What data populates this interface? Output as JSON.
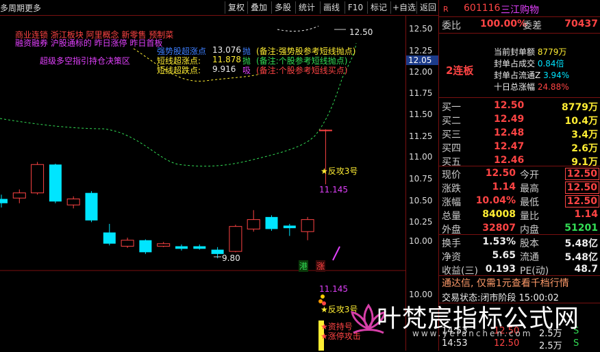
{
  "toolbar": {
    "period": "多周期",
    "more": "更多",
    "buttons": [
      "复权",
      "叠加",
      "多股",
      "统计",
      "画线",
      "F10",
      "标记",
      "+自选",
      "返回"
    ]
  },
  "chart": {
    "price_ticks": [
      "12.50",
      "12.25",
      "12.00",
      "11.75",
      "11.50",
      "11.25",
      "11.00",
      "10.75",
      "10.50",
      "10.25",
      "10.00"
    ],
    "current_price_tag": "12.05",
    "lower_ticks": [
      "10.00"
    ],
    "concepts_line1": "商业连锁  浙江板块  阿里概念 新零售 预制菜",
    "concepts_line2": "融资融券 沪股通标的 昨日涨停 昨日首板",
    "indicator_note": "超级多空指引持仓决策区",
    "levels": [
      {
        "label": "强势股超涨点",
        "value": "13.076",
        "action": "抛",
        "note": "(备注:强势股参考短线抛点)"
      },
      {
        "label": "短线超涨点:",
        "value": "11.878",
        "action": "抛",
        "note": "(备注:个股参考短线抛点)"
      },
      {
        "label": "短线超跌点:",
        "value": "9.916",
        "action": "吸",
        "note": "(备注:个股参考短线买点)"
      }
    ],
    "high_label": "12.50",
    "low_label": "9.80",
    "signal_label": "★反攻3号",
    "signal_value": "11.145",
    "lower_signal_value": "11.145",
    "lower_signal_1": "★反攻3号",
    "lower_signal_2": "★资持号",
    "lower_signal_3": "★涨停攻击",
    "hk_badge": "港",
    "zhang_badge": "涨",
    "candles": [
      {
        "o": 10.55,
        "c": 10.5,
        "h": 10.6,
        "l": 10.45
      },
      {
        "o": 10.56,
        "c": 10.62,
        "h": 10.66,
        "l": 10.5
      },
      {
        "o": 10.62,
        "c": 10.95,
        "h": 10.98,
        "l": 10.6
      },
      {
        "o": 10.95,
        "c": 10.52,
        "h": 10.96,
        "l": 10.5
      },
      {
        "o": 10.48,
        "c": 10.55,
        "h": 10.58,
        "l": 10.44
      },
      {
        "o": 10.62,
        "c": 10.3,
        "h": 10.64,
        "l": 10.28
      },
      {
        "o": 10.16,
        "c": 10.03,
        "h": 10.26,
        "l": 10.01
      },
      {
        "o": 10.0,
        "c": 10.07,
        "h": 10.1,
        "l": 9.98
      },
      {
        "o": 10.07,
        "c": 9.93,
        "h": 10.08,
        "l": 9.91
      },
      {
        "o": 10.0,
        "c": 10.03,
        "h": 10.05,
        "l": 9.99
      },
      {
        "o": 10.0,
        "c": 9.97,
        "h": 10.02,
        "l": 9.95
      },
      {
        "o": 10.0,
        "c": 9.97,
        "h": 10.02,
        "l": 9.96
      },
      {
        "o": 9.96,
        "c": 9.91,
        "h": 9.99,
        "l": 9.86
      },
      {
        "o": 9.94,
        "c": 10.23,
        "h": 10.25,
        "l": 9.93
      },
      {
        "o": 10.2,
        "c": 10.31,
        "h": 10.42,
        "l": 10.17
      },
      {
        "o": 10.34,
        "c": 10.2,
        "h": 10.36,
        "l": 10.18
      },
      {
        "o": 10.24,
        "c": 10.21,
        "h": 10.26,
        "l": 10.12
      },
      {
        "o": 10.17,
        "c": 10.31,
        "h": 10.34,
        "l": 10.07
      },
      {
        "o": 11.35,
        "c": 11.35,
        "h": 11.36,
        "l": 10.72
      }
    ]
  },
  "quote": {
    "code": "601116",
    "name": "三江购物",
    "weibi_label": "委比",
    "weibi": "100.00%",
    "weicha_label": "委差",
    "weicha": "70437",
    "lianban": "2连板",
    "stats": [
      {
        "label": "当前封单额",
        "value": "8779万"
      },
      {
        "label": "封单占成交",
        "value": "0.84倍"
      },
      {
        "label": "封单占流通Z",
        "value": "3.94%"
      },
      {
        "label": "十日总涨幅",
        "value": "24.88%"
      }
    ],
    "bids": [
      {
        "label": "买一",
        "price": "12.50",
        "vol": "8779万"
      },
      {
        "label": "买二",
        "price": "12.49",
        "vol": "10.4万"
      },
      {
        "label": "买三",
        "price": "12.48",
        "vol": "3.4万"
      },
      {
        "label": "买四",
        "price": "12.47",
        "vol": "2.6万"
      },
      {
        "label": "买五",
        "price": "12.46",
        "vol": "9.1万"
      }
    ],
    "grid1": [
      {
        "l1": "现价",
        "v1": "12.50",
        "l2": "今开",
        "v2": "12.50"
      },
      {
        "l1": "涨跌",
        "v1": "1.14",
        "l2": "最高",
        "v2": "12.50"
      },
      {
        "l1": "涨幅",
        "v1": "10.04%",
        "l2": "最低",
        "v2": "12.50"
      },
      {
        "l1": "总量",
        "v1": "84008",
        "l2": "量比",
        "v2": "1.14"
      },
      {
        "l1": "外盘",
        "v1": "32807",
        "l2": "内盘",
        "v2": "51201"
      }
    ],
    "grid2": [
      {
        "l1": "换手",
        "v1": "1.53%",
        "l2": "股本",
        "v2": "5.48亿"
      },
      {
        "l1": "净资",
        "v1": "5.65",
        "l2": "流通",
        "v2": "5.48亿"
      },
      {
        "l1": "收益(三)",
        "v1": "0.193",
        "l2": "PE(动)",
        "v2": "48.7"
      }
    ],
    "promo": "通达信, 仅需1元查看千档行情",
    "trade_status_label": "交易状态:",
    "trade_status": "闭市阶段 15:00:02",
    "ticks": [
      {
        "time": "14:53",
        "price": "12.50",
        "vol": "2.5万",
        "dir": "S"
      },
      {
        "time": "14:53",
        "price": "12.50",
        "vol": "2.5万",
        "dir": "S"
      }
    ]
  },
  "watermark": {
    "text": "叶梵宸指标公式网",
    "url": "www.yefanchen.com"
  },
  "colors": {
    "up": "#ff4444",
    "down": "#00e5ff",
    "bg": "#000000",
    "grid": "#7a1010",
    "yellow": "#ffee33",
    "green": "#33dd55",
    "magenta": "#e040fb"
  }
}
